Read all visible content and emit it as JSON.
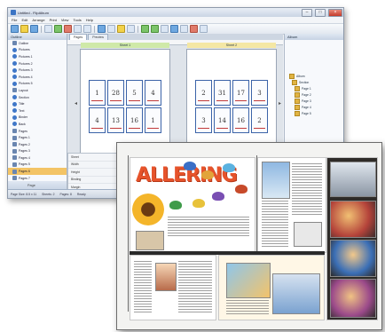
{
  "back_window": {
    "title": "Untitled - FlipAlbum",
    "menu": [
      "File",
      "Edit",
      "Arrange",
      "Print",
      "View",
      "Tools",
      "Help"
    ],
    "left_panel": {
      "header": "Outline",
      "items": [
        "Outline",
        "Pictures",
        "Pictures 1",
        "Pictures 2",
        "Pictures 3",
        "Pictures 4",
        "Pictures 5",
        "Layout",
        "Section",
        "Title",
        "Text",
        "Binder",
        "Back",
        "Pages",
        "Pages 1",
        "Pages 2",
        "Pages 3",
        "Pages 4",
        "Pages 5",
        "Pages 6",
        "Pages 7",
        "Pages 8",
        "Pages 9"
      ],
      "selected_index": 19,
      "bottom_label": "Page"
    },
    "tabs": [
      "Pages",
      "Preview"
    ],
    "spreads": [
      {
        "label": "Sheet 1",
        "top_row": [
          "1",
          "28",
          "5",
          "4"
        ],
        "bottom_row": [
          "4",
          "13",
          "16",
          "1"
        ]
      },
      {
        "label": "Sheet 2",
        "top_row": [
          "2",
          "31",
          "17",
          "3"
        ],
        "bottom_row": [
          "3",
          "14",
          "16",
          "2"
        ]
      }
    ],
    "properties": [
      "Sheet",
      "Width",
      "Height",
      "Binding",
      "Margin"
    ],
    "right_panel": {
      "header": "Album",
      "items": [
        "Album",
        "Section",
        "Page 1",
        "Page 2",
        "Page 3",
        "Page 4",
        "Page 5"
      ]
    },
    "status": [
      "Page Size: 8.5 x 11",
      "Sheets: 2",
      "Pages: 8",
      "Ready"
    ]
  },
  "preview": {
    "headline": "ALLERING",
    "colors": {
      "headline": "#e6532b",
      "frame": "#6c6c6c",
      "gutter": "#2a2a2a"
    }
  }
}
